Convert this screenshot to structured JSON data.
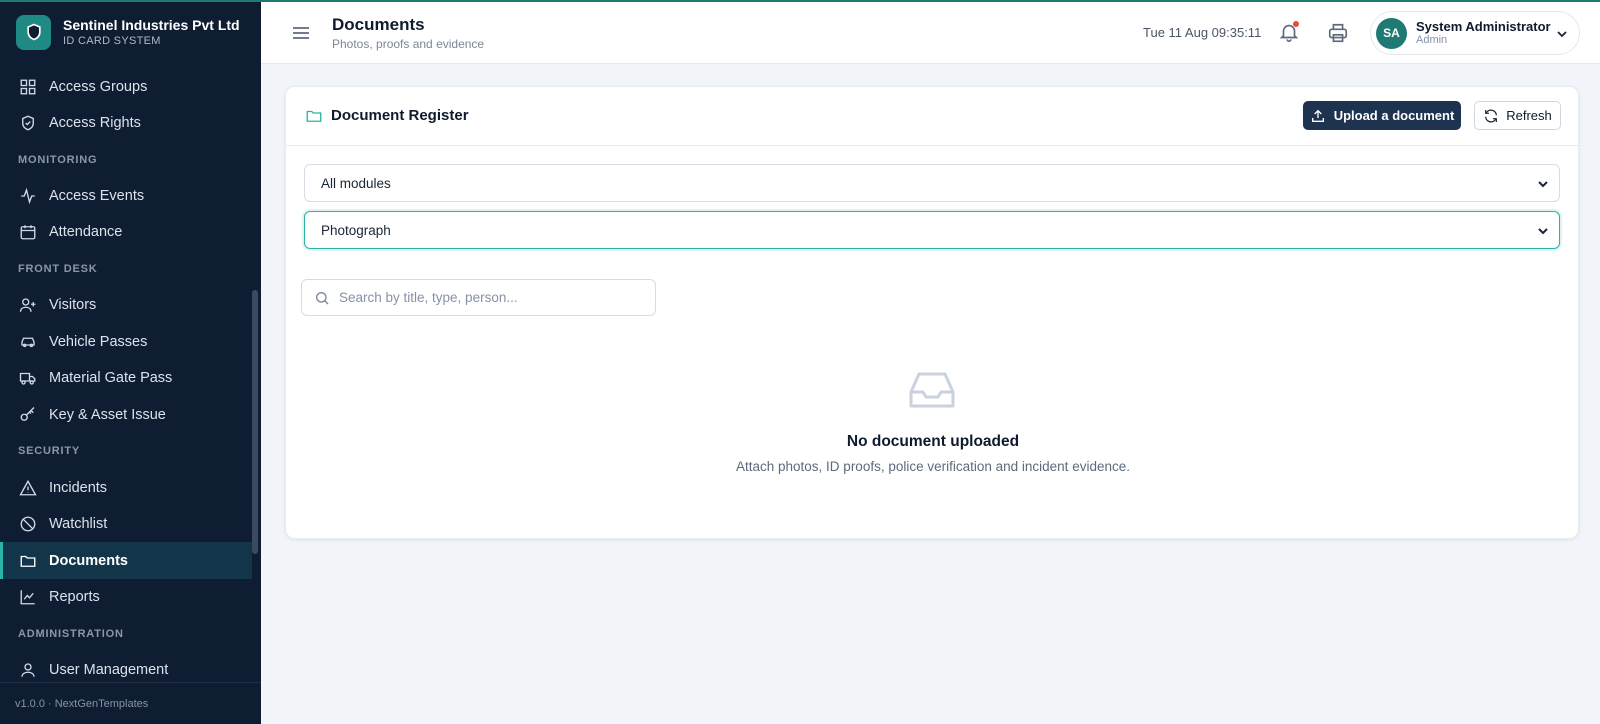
{
  "brand": {
    "name": "Sentinel Industries Pvt Ltd",
    "subtitle": "ID CARD SYSTEM"
  },
  "sidebar": {
    "items": [
      {
        "label": "Access Groups",
        "icon": "grid-icon"
      },
      {
        "label": "Access Rights",
        "icon": "shield-check-icon"
      },
      {
        "label": "Access Events",
        "icon": "activity-icon"
      },
      {
        "label": "Attendance",
        "icon": "calendar-icon"
      },
      {
        "label": "Visitors",
        "icon": "user-plus-icon"
      },
      {
        "label": "Vehicle Passes",
        "icon": "car-icon"
      },
      {
        "label": "Material Gate Pass",
        "icon": "truck-icon"
      },
      {
        "label": "Key & Asset Issue",
        "icon": "key-icon"
      },
      {
        "label": "Incidents",
        "icon": "alert-triangle-icon"
      },
      {
        "label": "Watchlist",
        "icon": "ban-icon"
      },
      {
        "label": "Documents",
        "icon": "folder-icon",
        "active": true
      },
      {
        "label": "Reports",
        "icon": "line-chart-icon"
      },
      {
        "label": "User Management",
        "icon": "user-icon"
      }
    ],
    "sections": [
      "MONITORING",
      "FRONT DESK",
      "SECURITY",
      "ADMINISTRATION"
    ],
    "footer": "v1.0.0 · NextGenTemplates"
  },
  "header": {
    "title": "Documents",
    "subtitle": "Photos, proofs and evidence",
    "clock": "Tue 11 Aug 09:35:11",
    "user": {
      "initials": "SA",
      "name": "System Administrator",
      "role": "Admin"
    }
  },
  "card": {
    "title": "Document Register",
    "upload_label": "Upload a document",
    "refresh_label": "Refresh",
    "module_select": "All modules",
    "type_select": "Photograph",
    "search_placeholder": "Search by title, type, person...",
    "empty_title": "No document uploaded",
    "empty_subtitle": "Attach photos, ID proofs, police verification and incident evidence."
  },
  "colors": {
    "sidebar_bg": "#0f1d33",
    "accent": "#2bb3a6",
    "primary_button": "#1e3350",
    "notification_dot": "#e14b3b"
  }
}
